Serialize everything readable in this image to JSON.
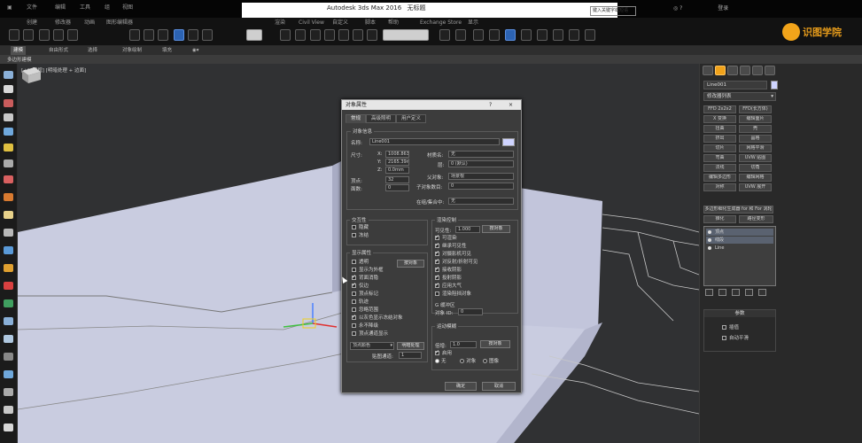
{
  "title_bar": {
    "menu": [
      "文件",
      "编辑",
      "工具",
      "组",
      "视图"
    ],
    "app_title": "Autodesk 3ds Max 2016",
    "doc": "无标题",
    "search_placeholder": "键入关键字或短语",
    "right_text": "登录"
  },
  "logo": {
    "text": "识图学院"
  },
  "menubar": {
    "items": [
      "创建",
      "修改器",
      "动画",
      "图形编辑器",
      "渲染",
      "Civil View",
      "自定义",
      "脚本",
      "帮助",
      "Exchange Store",
      "显示"
    ]
  },
  "ribbon": {
    "tabs": [
      "建模",
      "自由形式",
      "选择",
      "对象绘制",
      "填充"
    ],
    "sub_label": "多边形建模"
  },
  "viewport": {
    "label": "[+] [顶视] [明暗处理 + 边面]"
  },
  "command_panel": {
    "object_name": "Line001",
    "modifier_list": "修改器列表",
    "modifiers": [
      "FFD 2x2x2",
      "FFD(长方体)",
      "X 变换",
      "编辑面片",
      "扭曲",
      "壳",
      "挤出",
      "晶格",
      "切片",
      "网格平滑",
      "弯曲",
      "UVW 贴图",
      "法线",
      "切角",
      "编辑多边形",
      "编辑网格",
      "对称",
      "UVW 展开"
    ],
    "wide_btns": [
      "多边形细化生成器 for 和 For 涡轮",
      "锥化",
      "路径变形"
    ],
    "stack": [
      {
        "label": "顶点"
      },
      {
        "label": "线段"
      },
      {
        "label": "Line"
      }
    ],
    "params_head": "参数",
    "params_opts": [
      "插值",
      "自动平滑"
    ]
  },
  "dialog": {
    "title": "对象属性",
    "help": "?",
    "close": "×",
    "tabs": [
      "常规",
      "高级照明",
      "用户定义"
    ],
    "info": {
      "group": "对象信息",
      "name_label": "名称:",
      "name_value": "Line001",
      "dims_label": "尺寸:",
      "dims": [
        {
          "axis": "X:",
          "value": "1008.863mm"
        },
        {
          "axis": "Y:",
          "value": "2165.39mm"
        },
        {
          "axis": "Z:",
          "value": "0.0mm"
        }
      ],
      "faces_label": "顶点:",
      "faces_value": "32",
      "verts_label": "面数:",
      "verts_value": "0",
      "mat_label": "材质名:",
      "mat_value": "无",
      "layer_label": "层:",
      "layer_value": "0 (默认)",
      "parent_label": "父对象:",
      "parent_value": "场景根",
      "children_label": "子对象数目:",
      "children_value": "0",
      "group_label": "在组/集合中:",
      "group_value": "无"
    },
    "interactive": {
      "group": "交互性",
      "items": [
        {
          "label": "隐藏",
          "on": false
        },
        {
          "label": "冻结",
          "on": false
        }
      ]
    },
    "display": {
      "group": "显示属性",
      "by_layer_btn": "按对象",
      "items": [
        {
          "label": "透明",
          "on": false
        },
        {
          "label": "显示为外框",
          "on": false
        },
        {
          "label": "背面消隐",
          "on": true
        },
        {
          "label": "仅边",
          "on": true
        },
        {
          "label": "顶点标记",
          "on": false
        },
        {
          "label": "轨迹",
          "on": false
        },
        {
          "label": "忽略范围",
          "on": false
        },
        {
          "label": "以灰色显示冻结对象",
          "on": true
        },
        {
          "label": "永不降级",
          "on": false
        },
        {
          "label": "顶点通道显示",
          "on": false
        }
      ],
      "color_select": "顶点颜色",
      "shade_btn": "明暗处理",
      "map_label": "贴图通道:",
      "map_value": "1"
    },
    "render": {
      "group": "渲染控制",
      "vis_label": "可见性:",
      "vis_value": "1.000",
      "vis_btn": "按对象",
      "items": [
        {
          "label": "可渲染",
          "on": true
        },
        {
          "label": "继承可见性",
          "on": true
        },
        {
          "label": "对摄影机可见",
          "on": true
        },
        {
          "label": "对反射/折射可见",
          "on": true
        },
        {
          "label": "接收阴影",
          "on": true
        },
        {
          "label": "投射阴影",
          "on": true
        },
        {
          "label": "应用大气",
          "on": true
        },
        {
          "label": "渲染阻挡对象",
          "on": false
        }
      ],
      "gbuffer_group": "G 缓冲区",
      "gbuffer_label": "对象 ID:",
      "gbuffer_value": "0"
    },
    "motion_blur": {
      "group": "运动模糊",
      "mult_label": "倍增:",
      "mult_value": "1.0",
      "btn": "按对象",
      "enabled_label": "启用",
      "options": [
        "无",
        "对象",
        "图像"
      ]
    },
    "ok": "确定",
    "cancel": "取消"
  }
}
